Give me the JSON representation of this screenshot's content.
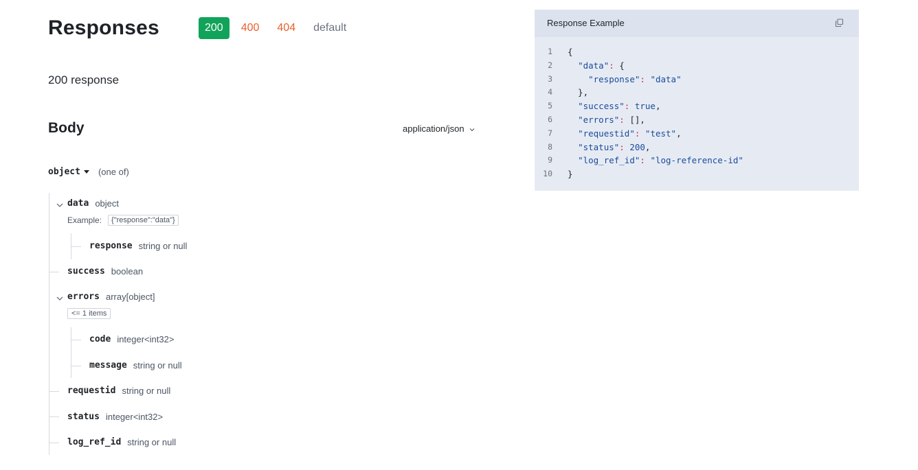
{
  "header": {
    "title": "Responses",
    "tabs": [
      {
        "label": "200",
        "state": "active"
      },
      {
        "label": "400",
        "state": "error"
      },
      {
        "label": "404",
        "state": "error"
      },
      {
        "label": "default",
        "state": "default"
      }
    ]
  },
  "subtitle": "200 response",
  "body": {
    "title": "Body",
    "media_type": "application/json",
    "root_keyword": "object",
    "root_note": "(one of)"
  },
  "schema": {
    "data": {
      "name": "data",
      "type": "object",
      "example_label": "Example:",
      "example_value": "{\"response\":\"data\"}"
    },
    "response": {
      "name": "response",
      "type": "string or null"
    },
    "success": {
      "name": "success",
      "type": "boolean"
    },
    "errors": {
      "name": "errors",
      "type": "array[object]",
      "constraint": "<= 1 items"
    },
    "code": {
      "name": "code",
      "type": "integer<int32>"
    },
    "message": {
      "name": "message",
      "type": "string or null"
    },
    "requestid": {
      "name": "requestid",
      "type": "string or null"
    },
    "status": {
      "name": "status",
      "type": "integer<int32>"
    },
    "log_ref_id": {
      "name": "log_ref_id",
      "type": "string or null"
    }
  },
  "example_panel": {
    "title": "Response Example",
    "line_numbers": [
      "1",
      "2",
      "3",
      "4",
      "5",
      "6",
      "7",
      "8",
      "9",
      "10"
    ],
    "lines": [
      [
        {
          "t": "p",
          "v": "{"
        }
      ],
      [
        {
          "t": "p",
          "v": "  "
        },
        {
          "t": "k",
          "v": "\"data\""
        },
        {
          "t": "c",
          "v": ":"
        },
        {
          "t": "p",
          "v": " {"
        }
      ],
      [
        {
          "t": "p",
          "v": "    "
        },
        {
          "t": "k",
          "v": "\"response\""
        },
        {
          "t": "c",
          "v": ":"
        },
        {
          "t": "p",
          "v": " "
        },
        {
          "t": "s",
          "v": "\"data\""
        }
      ],
      [
        {
          "t": "p",
          "v": "  },"
        }
      ],
      [
        {
          "t": "p",
          "v": "  "
        },
        {
          "t": "k",
          "v": "\"success\""
        },
        {
          "t": "c",
          "v": ":"
        },
        {
          "t": "p",
          "v": " "
        },
        {
          "t": "b",
          "v": "true"
        },
        {
          "t": "p",
          "v": ","
        }
      ],
      [
        {
          "t": "p",
          "v": "  "
        },
        {
          "t": "k",
          "v": "\"errors\""
        },
        {
          "t": "c",
          "v": ":"
        },
        {
          "t": "p",
          "v": " [],"
        }
      ],
      [
        {
          "t": "p",
          "v": "  "
        },
        {
          "t": "k",
          "v": "\"requestid\""
        },
        {
          "t": "c",
          "v": ":"
        },
        {
          "t": "p",
          "v": " "
        },
        {
          "t": "s",
          "v": "\"test\""
        },
        {
          "t": "p",
          "v": ","
        }
      ],
      [
        {
          "t": "p",
          "v": "  "
        },
        {
          "t": "k",
          "v": "\"status\""
        },
        {
          "t": "c",
          "v": ":"
        },
        {
          "t": "p",
          "v": " "
        },
        {
          "t": "b",
          "v": "200"
        },
        {
          "t": "p",
          "v": ","
        }
      ],
      [
        {
          "t": "p",
          "v": "  "
        },
        {
          "t": "k",
          "v": "\"log_ref_id\""
        },
        {
          "t": "c",
          "v": ":"
        },
        {
          "t": "p",
          "v": " "
        },
        {
          "t": "s",
          "v": "\"log-reference-id\""
        }
      ],
      [
        {
          "t": "p",
          "v": "}"
        }
      ]
    ]
  },
  "colors": {
    "active_tab": "#12a35a",
    "error_tab": "#e8612c",
    "panel_bg": "#e6ebf3",
    "code_key": "#1a4a9c",
    "code_colon": "#c22b5c"
  },
  "icons": {
    "media_dropdown": "chevron-down-icon",
    "root_caret": "caret-down-icon",
    "collapse": "chevron-down-icon",
    "copy": "copy-icon"
  }
}
